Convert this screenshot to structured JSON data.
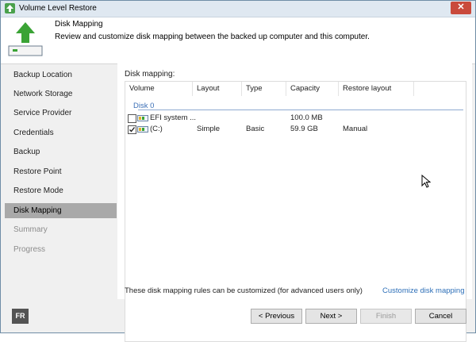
{
  "window": {
    "title": "Volume Level Restore",
    "close_glyph": "✕"
  },
  "header": {
    "title": "Disk Mapping",
    "description": "Review and customize disk mapping between the backed up computer and this computer.",
    "icon": "restore-volume-icon"
  },
  "sidebar": {
    "items": [
      {
        "label": "Backup Location",
        "state": "normal"
      },
      {
        "label": "Network Storage",
        "state": "normal"
      },
      {
        "label": "Service Provider",
        "state": "normal"
      },
      {
        "label": "Credentials",
        "state": "normal"
      },
      {
        "label": "Backup",
        "state": "normal"
      },
      {
        "label": "Restore Point",
        "state": "normal"
      },
      {
        "label": "Restore Mode",
        "state": "normal"
      },
      {
        "label": "Disk Mapping",
        "state": "active"
      },
      {
        "label": "Summary",
        "state": "disabled"
      },
      {
        "label": "Progress",
        "state": "disabled"
      }
    ]
  },
  "main": {
    "disk_mapping_label": "Disk mapping:",
    "columns": [
      "Volume",
      "Layout",
      "Type",
      "Capacity",
      "Restore layout"
    ],
    "disk_group": "Disk 0",
    "rows": [
      {
        "checked": false,
        "volume": "EFI system ...",
        "layout": "",
        "type": "",
        "capacity": "100.0 MB",
        "restore_layout": ""
      },
      {
        "checked": true,
        "volume": "(C:)",
        "layout": "Simple",
        "type": "Basic",
        "capacity": "59.9 GB",
        "restore_layout": "Manual"
      }
    ],
    "footer_note": "These disk mapping rules can be customized (for advanced users only)",
    "customize_link": "Customize disk mapping"
  },
  "buttons": {
    "previous": "< Previous",
    "next": "Next >",
    "finish": "Finish",
    "cancel": "Cancel"
  },
  "badge": "FR",
  "colors": {
    "accent": "#2d6fb8",
    "active_nav": "#a9a9a9",
    "close": "#c94a3c",
    "header_icon": "#3aa335"
  }
}
